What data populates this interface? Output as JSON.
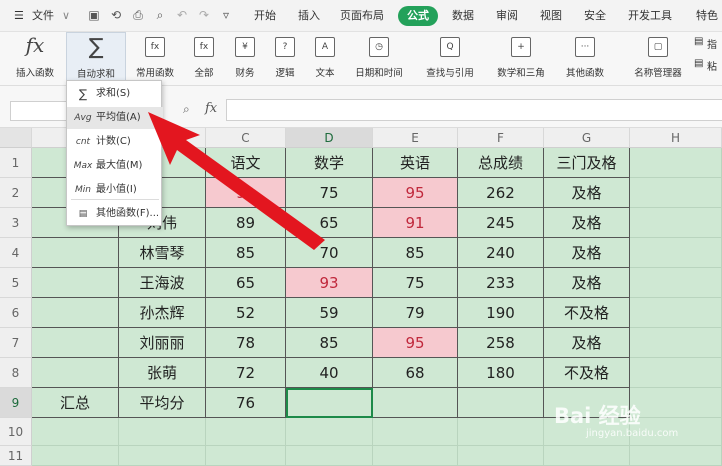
{
  "menubar": {
    "file": "文件",
    "tabs": [
      "开始",
      "插入",
      "页面布局",
      "公式",
      "数据",
      "审阅",
      "视图",
      "安全",
      "开发工具",
      "特色"
    ],
    "active_tab": "公式"
  },
  "ribbon": {
    "items": [
      "插入函数",
      "自动求和",
      "常用函数",
      "全部",
      "财务",
      "逻辑",
      "文本",
      "日期和时间",
      "查找与引用",
      "数学和三角",
      "其他函数",
      "名称管理器",
      "指",
      "粘"
    ],
    "icon_glyphs": [
      "fx",
      "∑",
      "fx",
      "fx",
      "¥",
      "?",
      "A",
      "◷",
      "Q",
      "+",
      "···",
      "▢",
      "▤",
      "▤"
    ]
  },
  "formulabar": {
    "fx": "fx"
  },
  "dropdown": {
    "items": [
      {
        "icon": "∑",
        "label": "求和(S)"
      },
      {
        "icon": "Avg",
        "label": "平均值(A)"
      },
      {
        "icon": "cnt",
        "label": "计数(C)"
      },
      {
        "icon": "Max",
        "label": "最大值(M)"
      },
      {
        "icon": "Min",
        "label": "最小值(I)"
      },
      {
        "icon": "▤",
        "label": "其他函数(F)..."
      }
    ],
    "highlighted": 1
  },
  "grid": {
    "columns": [
      "C",
      "D",
      "E",
      "F",
      "G",
      "H"
    ],
    "row_numbers": [
      "1",
      "2",
      "3",
      "4",
      "5",
      "6",
      "7",
      "8",
      "9",
      "10",
      "11"
    ],
    "header_row": [
      "班",
      "",
      "语文",
      "数学",
      "英语",
      "总成绩",
      "三门及格"
    ],
    "rows": [
      [
        "一",
        "",
        "92",
        "75",
        "95",
        "262",
        "及格"
      ],
      [
        "",
        "刘伟",
        "89",
        "65",
        "91",
        "245",
        "及格"
      ],
      [
        "",
        "林雪琴",
        "85",
        "70",
        "85",
        "240",
        "及格"
      ],
      [
        "",
        "王海波",
        "65",
        "93",
        "75",
        "233",
        "及格"
      ],
      [
        "",
        "孙杰辉",
        "52",
        "59",
        "79",
        "190",
        "不及格"
      ],
      [
        "",
        "刘丽丽",
        "78",
        "85",
        "95",
        "258",
        "及格"
      ],
      [
        "",
        "张萌",
        "72",
        "40",
        "68",
        "180",
        "不及格"
      ],
      [
        "汇总",
        "平均分",
        "76",
        "",
        "",
        "",
        ""
      ]
    ],
    "highlight_colors": {
      "cell": "#cfe8d3",
      "pink": "#f6c9cf",
      "pink_text": "#c0283c"
    }
  },
  "watermark": {
    "main": "Bai 经验",
    "sub": "jingyan.baidu.com"
  }
}
